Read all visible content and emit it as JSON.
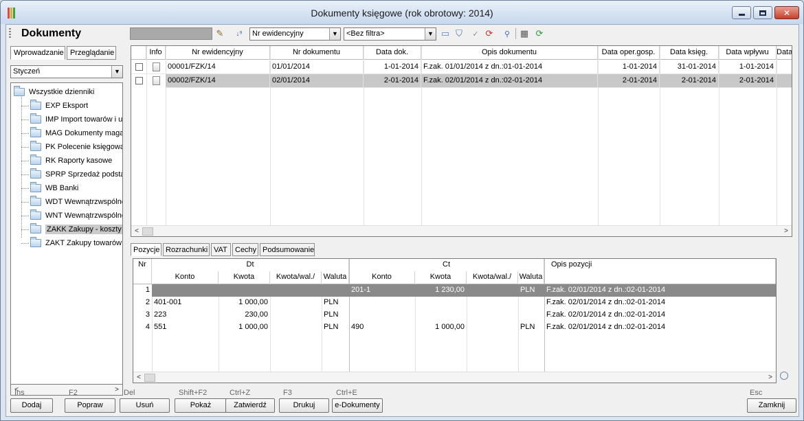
{
  "window": {
    "title": "Dokumenty księgowe (rok obrotowy: 2014)"
  },
  "toolbar": {
    "page_title": "Dokumenty",
    "sort_combo": "Nr ewidencyjny",
    "filter_combo": "<Bez filtra>"
  },
  "left_panel": {
    "tabs": [
      "Wprowadzanie",
      "Przeglądanie"
    ],
    "month": "Styczeń",
    "tree_root": "Wszystkie dzienniki",
    "tree_items": [
      "EXP Eksport",
      "IMP Import towarów i usług",
      "MAG Dokumenty magazynowe",
      "PK Polecenie księgowania",
      "RK Raporty kasowe",
      "SPRP Sprzedaż podstawowa",
      "WB Banki",
      "WDT Wewnątrzwspólnotowa",
      "WNT Wewnątrzwspólnotowe",
      "ZAKK Zakupy - koszty",
      "ZAKT Zakupy towarów"
    ],
    "selected_index": 9
  },
  "documents": {
    "columns": [
      "Info",
      "Nr ewidencyjny",
      "Nr dokumentu",
      "Data dok.",
      "Opis dokumentu",
      "Data oper.gosp.",
      "Data księg.",
      "Data wpływu",
      "Data"
    ],
    "rows": [
      {
        "nr_ewid": "00001/FZK/14",
        "nr_dok": "01/01/2014",
        "data_dok": "1-01-2014",
        "opis": "F.zak. 01/01/2014 z dn.:01-01-2014",
        "data_oper": "1-01-2014",
        "data_ksieg": "31-01-2014",
        "data_wplywu": "1-01-2014"
      },
      {
        "nr_ewid": "00002/FZK/14",
        "nr_dok": "02/01/2014",
        "data_dok": "2-01-2014",
        "opis": "F.zak. 02/01/2014 z dn.:02-01-2014",
        "data_oper": "2-01-2014",
        "data_ksieg": "2-01-2014",
        "data_wplywu": "2-01-2014"
      }
    ]
  },
  "detail_tabs": [
    "Pozycje",
    "Rozrachunki",
    "VAT",
    "Cechy",
    "Podsumowanie"
  ],
  "positions": {
    "header_nr": "Nr",
    "header_dt": "Dt",
    "header_ct": "Ct",
    "header_opis": "Opis pozycji",
    "sub_headers": [
      "Konto",
      "Kwota",
      "Kwota/wal./",
      "Waluta",
      "Konto",
      "Kwota",
      "Kwota/wal./",
      "Waluta"
    ],
    "rows": [
      {
        "nr": "1",
        "dt_konto": "",
        "dt_kwota": "",
        "dt_kwota_wal": "",
        "dt_waluta": "",
        "ct_konto": "201-1",
        "ct_kwota": "1 230,00",
        "ct_kwota_wal": "",
        "ct_waluta": "PLN",
        "opis": "F.zak. 02/01/2014 z dn.:02-01-2014"
      },
      {
        "nr": "2",
        "dt_konto": "401-001",
        "dt_kwota": "1 000,00",
        "dt_kwota_wal": "",
        "dt_waluta": "PLN",
        "ct_konto": "",
        "ct_kwota": "",
        "ct_kwota_wal": "",
        "ct_waluta": "",
        "opis": "F.zak. 02/01/2014 z dn.:02-01-2014"
      },
      {
        "nr": "3",
        "dt_konto": "223",
        "dt_kwota": "230,00",
        "dt_kwota_wal": "",
        "dt_waluta": "PLN",
        "ct_konto": "",
        "ct_kwota": "",
        "ct_kwota_wal": "",
        "ct_waluta": "",
        "opis": "F.zak. 02/01/2014 z dn.:02-01-2014"
      },
      {
        "nr": "4",
        "dt_konto": "551",
        "dt_kwota": "1 000,00",
        "dt_kwota_wal": "",
        "dt_waluta": "PLN",
        "ct_konto": "490",
        "ct_kwota": "1 000,00",
        "ct_kwota_wal": "",
        "ct_waluta": "PLN",
        "opis": "F.zak. 02/01/2014 z dn.:02-01-2014"
      }
    ]
  },
  "footer": {
    "buttons": [
      {
        "key": "Ins",
        "label": "Dodaj"
      },
      {
        "key": "F2",
        "label": "Popraw"
      },
      {
        "key": "Del",
        "label": "Usuń"
      },
      {
        "key": "Shift+F2",
        "label": "Pokaż"
      },
      {
        "key": "Ctrl+Z",
        "label": "Zatwierdź"
      },
      {
        "key": "F3",
        "label": "Drukuj"
      },
      {
        "key": "Ctrl+E",
        "label": "e-Dokumenty"
      }
    ],
    "close": {
      "key": "Esc",
      "label": "Zamknij"
    }
  },
  "colors": {
    "selected_row": "#c8c8c8",
    "selected_position": "#8a8a8a"
  }
}
